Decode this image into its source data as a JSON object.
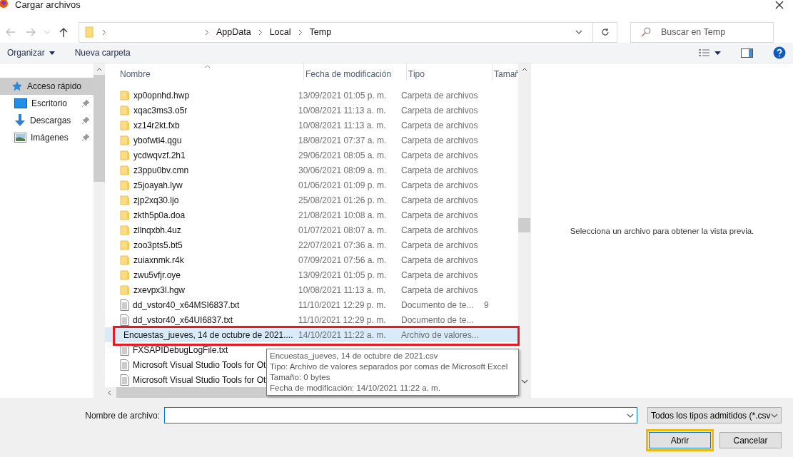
{
  "window": {
    "title": "Cargar archivos"
  },
  "address": {
    "segments": [
      "AppData",
      "Local",
      "Temp"
    ]
  },
  "search": {
    "placeholder": "Buscar en Temp"
  },
  "toolbar": {
    "organize": "Organizar",
    "new_folder": "Nueva carpeta"
  },
  "sidebar": {
    "items": [
      {
        "label": "Acceso rápido",
        "selected": true,
        "pinned": false
      },
      {
        "label": "Escritorio",
        "selected": false,
        "pinned": true
      },
      {
        "label": "Descargas",
        "selected": false,
        "pinned": true
      },
      {
        "label": "Imágenes",
        "selected": false,
        "pinned": true
      }
    ]
  },
  "table": {
    "columns": [
      "Nombre",
      "Fecha de modificación",
      "Tipo",
      "Tamañ"
    ],
    "rows": [
      {
        "kind": "folder",
        "name": "xp0opnhd.hwp",
        "date": "13/09/2021 01:05 p. m.",
        "type": "Carpeta de archivos",
        "selected": false
      },
      {
        "kind": "folder",
        "name": "xqac3ms3.o5r",
        "date": "10/08/2021 11:13 a. m.",
        "type": "Carpeta de archivos",
        "selected": false
      },
      {
        "kind": "folder",
        "name": "xz14r2kt.fxb",
        "date": "10/08/2021 11:13 a. m.",
        "type": "Carpeta de archivos",
        "selected": false
      },
      {
        "kind": "folder",
        "name": "ybofwti4.qgu",
        "date": "18/08/2021 07:37 a. m.",
        "type": "Carpeta de archivos",
        "selected": false
      },
      {
        "kind": "folder",
        "name": "ycdwqvzf.2h1",
        "date": "29/06/2021 08:05 a. m.",
        "type": "Carpeta de archivos",
        "selected": false
      },
      {
        "kind": "folder",
        "name": "z3ppu0bv.cmn",
        "date": "30/06/2021 08:09 a. m.",
        "type": "Carpeta de archivos",
        "selected": false
      },
      {
        "kind": "folder",
        "name": "z5joayah.lyw",
        "date": "01/06/2021 01:09 p. m.",
        "type": "Carpeta de archivos",
        "selected": false
      },
      {
        "kind": "folder",
        "name": "zjp2xq30.ljo",
        "date": "25/08/2021 01:26 p. m.",
        "type": "Carpeta de archivos",
        "selected": false
      },
      {
        "kind": "folder",
        "name": "zkth5p0a.doa",
        "date": "21/08/2021 10:08 a. m.",
        "type": "Carpeta de archivos",
        "selected": false
      },
      {
        "kind": "folder",
        "name": "zllnqxbh.4uz",
        "date": "01/07/2021 08:07 a. m.",
        "type": "Carpeta de archivos",
        "selected": false
      },
      {
        "kind": "folder",
        "name": "zoo3pts5.bt5",
        "date": "22/07/2021 07:36 a. m.",
        "type": "Carpeta de archivos",
        "selected": false
      },
      {
        "kind": "folder",
        "name": "zuiaxnmk.r4k",
        "date": "07/09/2021 07:56 a. m.",
        "type": "Carpeta de archivos",
        "selected": false
      },
      {
        "kind": "folder",
        "name": "zwu5vfjr.oye",
        "date": "13/09/2021 01:05 p. m.",
        "type": "Carpeta de archivos",
        "selected": false
      },
      {
        "kind": "folder",
        "name": "zxevpx3l.hgw",
        "date": "10/08/2021 11:13 a. m.",
        "type": "Carpeta de archivos",
        "selected": false
      },
      {
        "kind": "text",
        "name": "dd_vstor40_x64MSI6837.txt",
        "date": "11/10/2021 12:29 p. m.",
        "type": "Documento de te...",
        "size": "9",
        "selected": false
      },
      {
        "kind": "text",
        "name": "dd_vstor40_x64UI6837.txt",
        "date": "11/10/2021 12:29 p. m.",
        "type": "Documento de te...",
        "selected": false
      },
      {
        "kind": "excel",
        "name": "Encuestas_jueves, 14 de octubre de 2021....",
        "date": "14/10/2021 11:22 a. m.",
        "type": "Archivo de valores...",
        "selected": true
      },
      {
        "kind": "text",
        "name": "FXSAPIDebugLogFile.txt",
        "selected": false
      },
      {
        "kind": "text",
        "name": "Microsoft Visual Studio Tools for Ot",
        "selected": false
      },
      {
        "kind": "text",
        "name": "Microsoft Visual Studio Tools for Ot",
        "selected": false
      }
    ]
  },
  "tooltip": {
    "lines": [
      "Encuestas_jueves, 14 de octubre de 2021.csv",
      "Tipo: Archivo de valores separados por comas de Microsoft Excel",
      "Tamaño: 0 bytes",
      "Fecha de modificación: 14/10/2021 11:22 a. m."
    ]
  },
  "preview": {
    "message": "Selecciona un archivo para obtener la vista previa."
  },
  "footer": {
    "filename_label": "Nombre de archivo:",
    "filter": "Todos los tipos admitidos (*.csv",
    "open": "Abrir",
    "cancel": "Cancelar"
  }
}
